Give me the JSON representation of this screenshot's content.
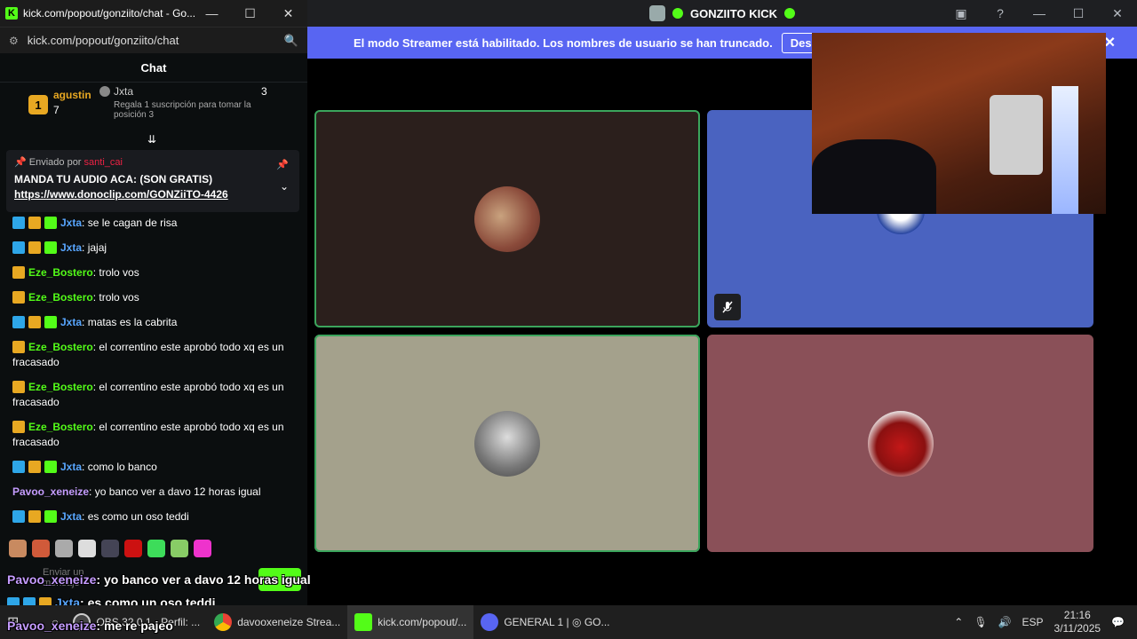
{
  "kick_window": {
    "title": "kick.com/popout/gonziito/chat - Go...",
    "url": "kick.com/popout/gonziito/chat",
    "header": "Chat",
    "leaderboard": {
      "first": {
        "rank": "1",
        "name": "agustin",
        "count": "7"
      },
      "second": {
        "name": "Jxta",
        "count": "3",
        "hint": "Regala 1 suscripción para tomar la posición 3"
      }
    },
    "pinned": {
      "sent_by_label": "Enviado por",
      "sent_by_user": "santi_cai",
      "message": "MANDA TU AUDIO ACA: (SON GRATIS)",
      "link": "https://www.donoclip.com/GONZiiTO-4426"
    },
    "messages": [
      {
        "user": "Jxta",
        "color": "#58a6ff",
        "badges": [
          "staff",
          "crown",
          "sub"
        ],
        "text": "se le cagan de risa"
      },
      {
        "user": "Jxta",
        "color": "#58a6ff",
        "badges": [
          "staff",
          "crown",
          "sub"
        ],
        "text": "jajaj"
      },
      {
        "user": "Eze_Bostero",
        "color": "#53fc18",
        "badges": [
          "crown"
        ],
        "text": "trolo vos"
      },
      {
        "user": "Eze_Bostero",
        "color": "#53fc18",
        "badges": [
          "crown"
        ],
        "text": "trolo vos"
      },
      {
        "user": "Jxta",
        "color": "#58a6ff",
        "badges": [
          "staff",
          "crown",
          "sub"
        ],
        "text": "matas es la cabrita"
      },
      {
        "user": "Eze_Bostero",
        "color": "#53fc18",
        "badges": [
          "crown"
        ],
        "text": "el correntino este aprobó todo xq es un fracasado"
      },
      {
        "user": "Eze_Bostero",
        "color": "#53fc18",
        "badges": [
          "crown"
        ],
        "text": "el correntino este aprobó todo xq es un fracasado"
      },
      {
        "user": "Eze_Bostero",
        "color": "#53fc18",
        "badges": [
          "crown"
        ],
        "text": "el correntino este aprobó todo xq es un fracasado"
      },
      {
        "user": "Jxta",
        "color": "#58a6ff",
        "badges": [
          "staff",
          "crown",
          "sub"
        ],
        "text": "como lo banco"
      },
      {
        "user": "Pavoo_xeneize",
        "color": "#c59cff",
        "badges": [],
        "text": "yo banco ver a davo 12 horas igual"
      },
      {
        "user": "Jxta",
        "color": "#58a6ff",
        "badges": [
          "staff",
          "crown",
          "sub"
        ],
        "text": "es como un oso teddi"
      },
      {
        "user": "Pavoo_xeneize",
        "color": "#c59cff",
        "badges": [],
        "text": "me re pajeo"
      }
    ],
    "send_placeholder": "Enviar un mensaje"
  },
  "discord": {
    "title": "GONZIITO KICK",
    "banner_text": "El modo Streamer está habilitado. Los nombres de usuario se han truncado.",
    "banner_button": "Deshabilitar"
  },
  "overlay": [
    {
      "user": "Pavoo_xeneize",
      "text": ": yo banco ver a davo 12 horas igual"
    },
    {
      "user": "Jxta",
      "text": ": es como un oso teddi"
    },
    {
      "user": "Pavoo_xeneize",
      "text": ": me re pajeo"
    }
  ],
  "taskbar": {
    "items": [
      "OBS 32.0.1 - Perfil: ...",
      "davooxeneize Strea...",
      "kick.com/popout/...",
      "GENERAL 1 | ◎ GO..."
    ],
    "lang": "ESP",
    "time": "21:16",
    "date": "3/11/2025"
  },
  "colors": {
    "kick_green": "#53fc18",
    "discord_blurple": "#5865f2"
  }
}
